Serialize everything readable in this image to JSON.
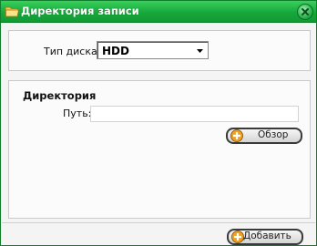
{
  "window": {
    "title": "Директория записи"
  },
  "disk": {
    "label": "Тип диска:",
    "selected": "HDD"
  },
  "directory": {
    "section_title": "Директория",
    "path_label": "Путь:",
    "path_value": "",
    "browse_label": "Обзор"
  },
  "footer": {
    "add_label": "Добавить"
  },
  "colors": {
    "titlebar": "#17a83c",
    "icon_plus": "#f0a020"
  },
  "icons": {
    "title": "folder-icon",
    "close": "close-icon",
    "button": "plus-icon"
  }
}
